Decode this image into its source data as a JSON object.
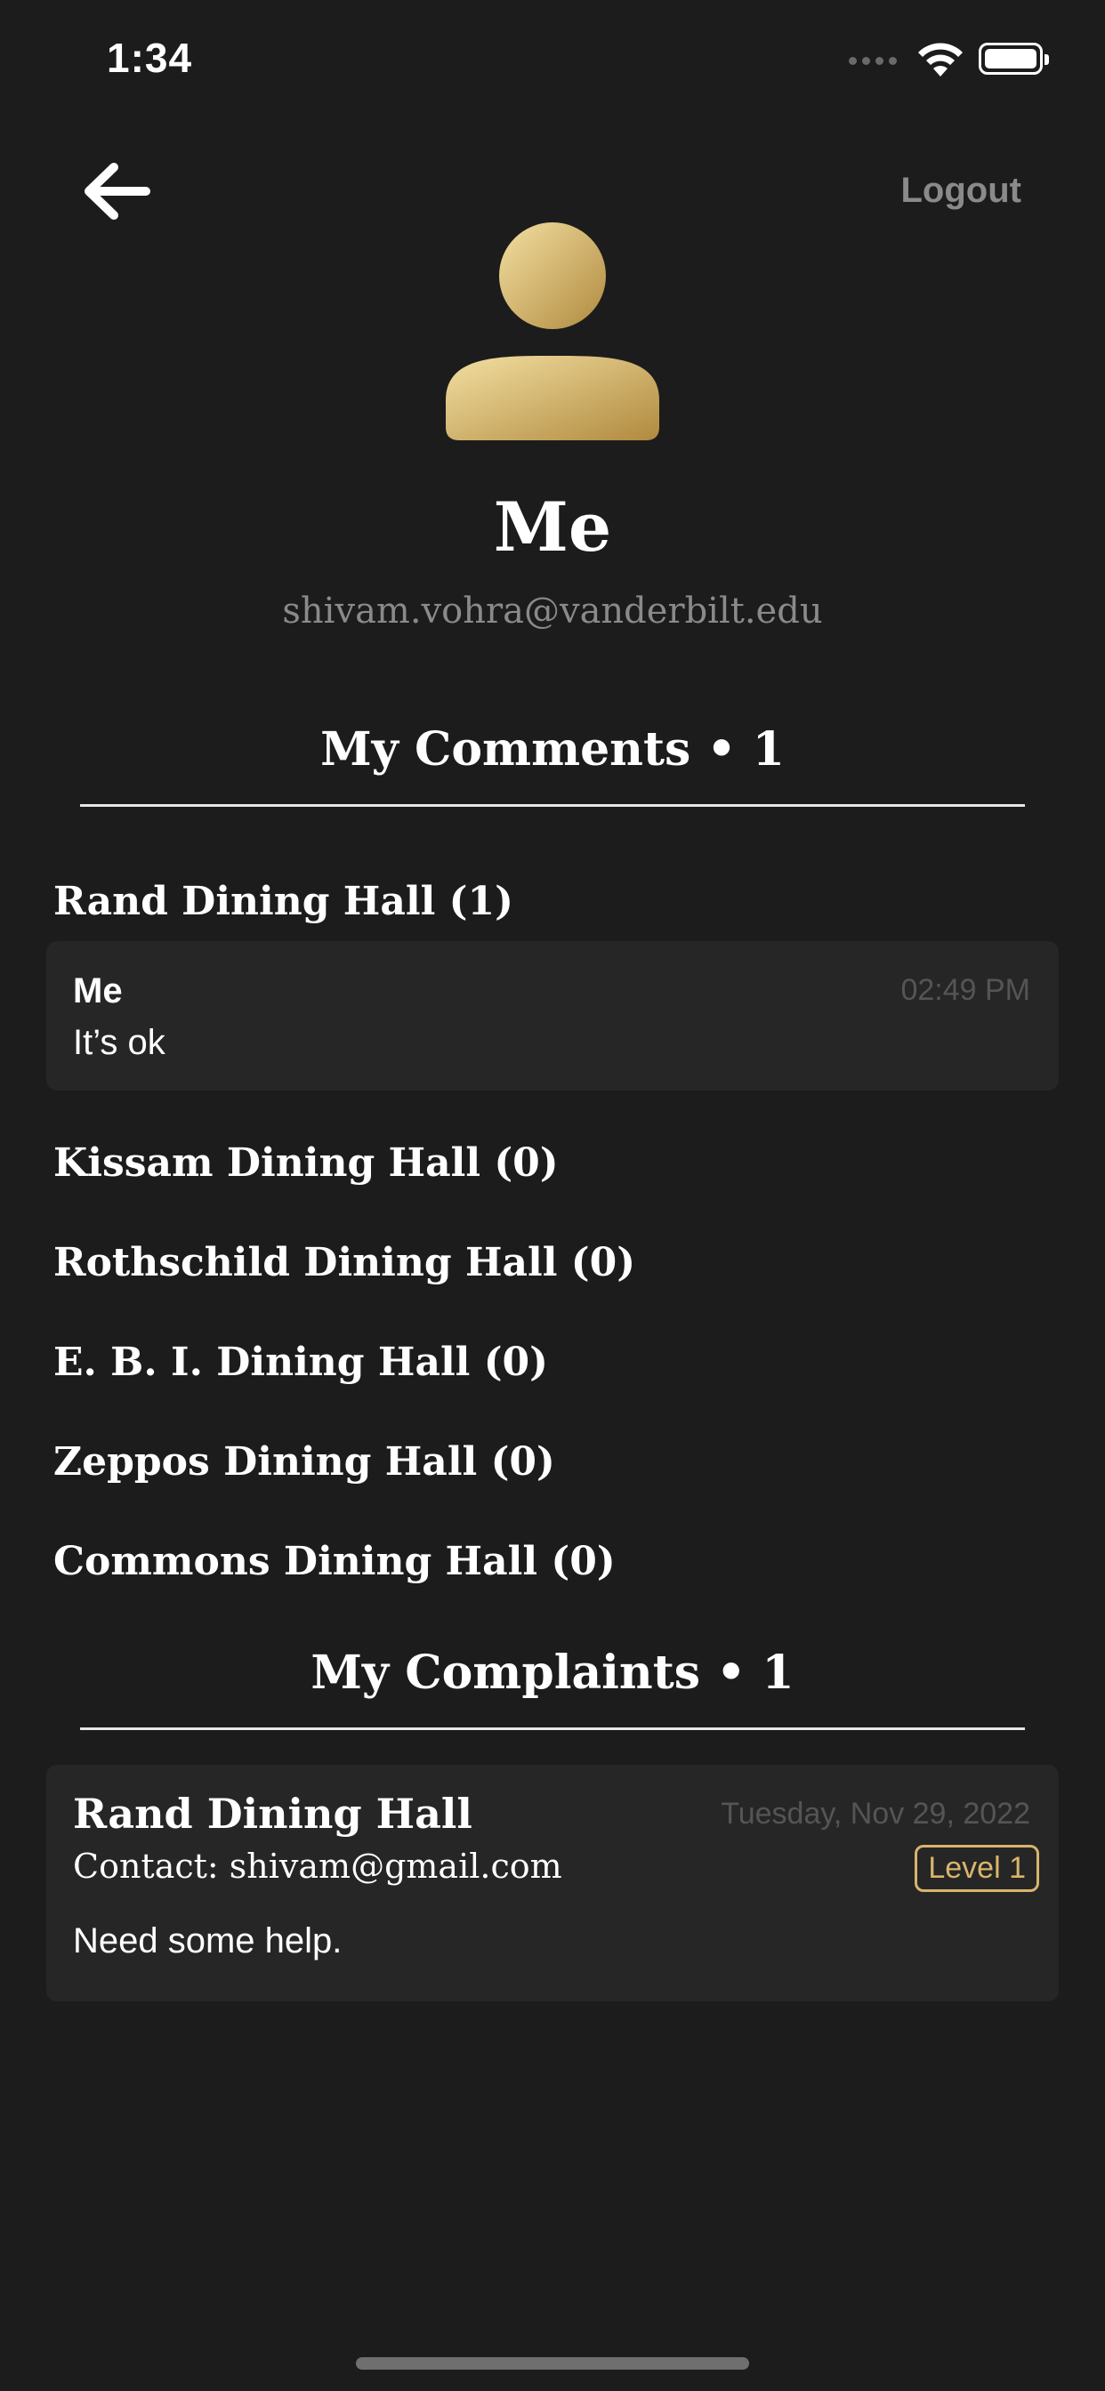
{
  "status_bar": {
    "time": "1:34"
  },
  "header": {
    "logout_label": "Logout"
  },
  "profile": {
    "name": "Me",
    "email": "shivam.vohra@vanderbilt.edu"
  },
  "comments_section": {
    "title": "My Comments • 1",
    "halls": [
      {
        "label": "Rand Dining Hall (1)"
      },
      {
        "label": "Kissam Dining Hall (0)"
      },
      {
        "label": "Rothschild Dining Hall (0)"
      },
      {
        "label": "E. B. I. Dining Hall (0)"
      },
      {
        "label": "Zeppos Dining Hall (0)"
      },
      {
        "label": "Commons Dining Hall (0)"
      }
    ],
    "comment": {
      "author": "Me",
      "time": "02:49 PM",
      "text": "It’s ok"
    }
  },
  "complaints_section": {
    "title": "My Complaints • 1",
    "complaint": {
      "hall": "Rand Dining Hall",
      "date": "Tuesday, Nov 29, 2022",
      "contact": "Contact: shivam@gmail.com",
      "level": "Level 1",
      "text": "Need some help."
    }
  },
  "colors": {
    "background": "#1c1c1c",
    "card": "#262626",
    "gold_light": "#f3dfa2",
    "gold_dark": "#b08a3e",
    "level_badge": "#d9b56c",
    "muted_text": "#8a8a8a"
  },
  "icons": {
    "back": "arrow-left-icon",
    "avatar": "person-icon",
    "wifi": "wifi-icon",
    "battery": "battery-icon"
  }
}
